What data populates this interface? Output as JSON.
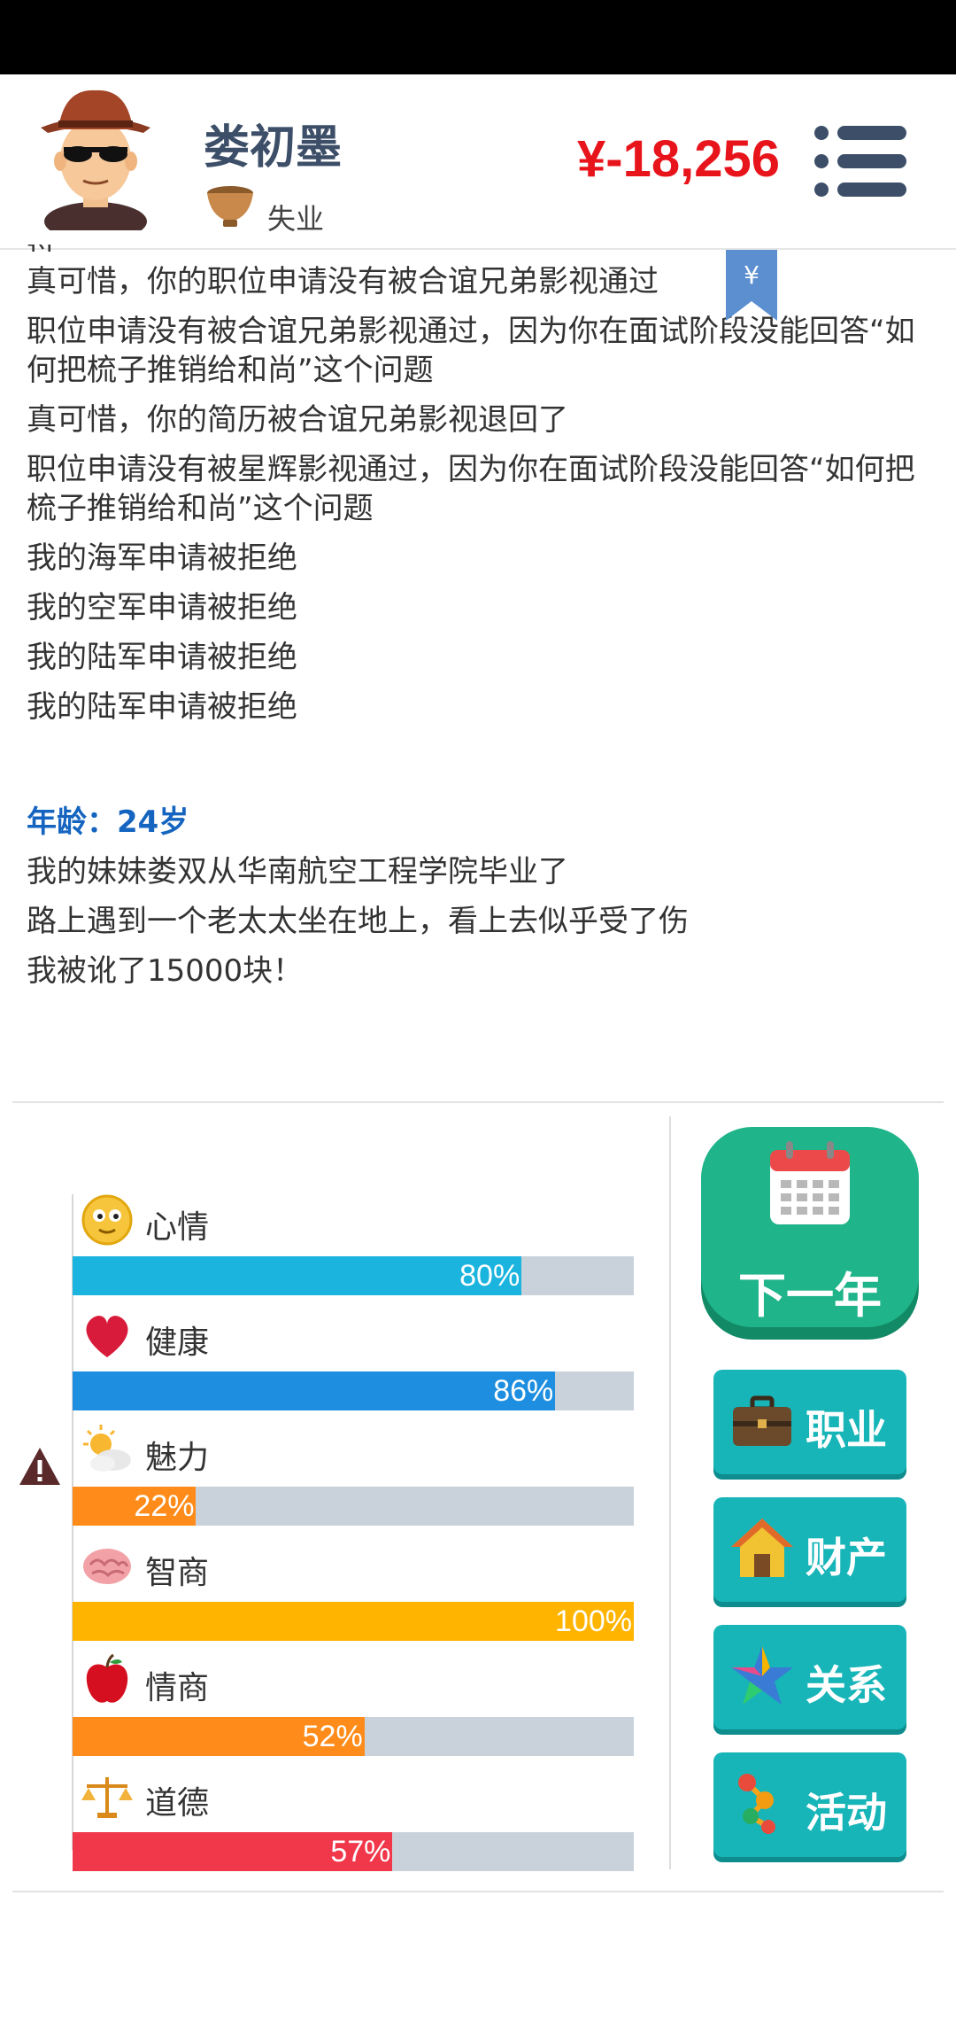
{
  "header": {
    "name": "娄初墨",
    "job": "失业",
    "money": "¥-18,256"
  },
  "log": {
    "partial_line": "过",
    "lines_before_age": [
      "真可惜，你的职位申请没有被合谊兄弟影视通过",
      "职位申请没有被合谊兄弟影视通过，因为你在面试阶段没能回答“如何把梳子推销给和尚”这个问题",
      "真可惜，你的简历被合谊兄弟影视退回了",
      "职位申请没有被星辉影视通过，因为你在面试阶段没能回答“如何把梳子推销给和尚”这个问题",
      "我的海军申请被拒绝",
      "我的空军申请被拒绝",
      "我的陆军申请被拒绝",
      "我的陆军申请被拒绝"
    ],
    "age_label": "年龄：24岁",
    "lines_after_age": [
      "我的妹妹娄双从华南航空工程学院毕业了",
      "路上遇到一个老太太坐在地上，看上去似乎受了伤",
      "我被讹了15000块！"
    ],
    "bookmark_symbol": "¥"
  },
  "stats": [
    {
      "label": "心情",
      "value": 80,
      "text": "80%",
      "color": "#1bb4de",
      "icon": "smiley-icon"
    },
    {
      "label": "健康",
      "value": 86,
      "text": "86%",
      "color": "#1e8fe0",
      "icon": "heart-icon"
    },
    {
      "label": "魅力",
      "value": 22,
      "text": "22%",
      "color": "#ff8c1a",
      "icon": "sun-cloud-icon",
      "warning": true
    },
    {
      "label": "智商",
      "value": 100,
      "text": "100%",
      "color": "#ffb400",
      "icon": "brain-icon"
    },
    {
      "label": "情商",
      "value": 52,
      "text": "52%",
      "color": "#ff8c1a",
      "icon": "apple-icon"
    },
    {
      "label": "道德",
      "value": 57,
      "text": "57%",
      "color": "#f0384a",
      "icon": "scales-icon"
    }
  ],
  "buttons": {
    "next_year": "下一年",
    "career": "职业",
    "assets": "财产",
    "relations": "关系",
    "activities": "活动"
  },
  "colors": {
    "money": "#e8141c",
    "primary_button": "#1fb489",
    "side_button": "#17b5b8",
    "name": "#3d4f68",
    "age_label": "#1565c0"
  }
}
